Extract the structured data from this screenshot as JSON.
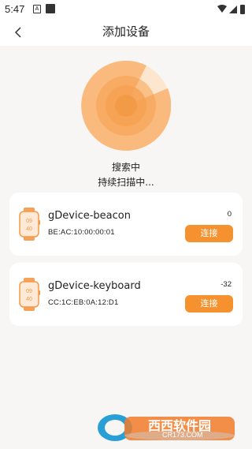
{
  "status_bar": {
    "time": "5:47"
  },
  "header": {
    "title": "添加设备"
  },
  "search": {
    "status": "搜索中",
    "sub_status": "持续扫描中..."
  },
  "devices": [
    {
      "name": "gDevice-beacon",
      "mac": "BE:AC:10:00:00:01",
      "rssi": "0",
      "connect_label": "连接"
    },
    {
      "name": "gDevice-keyboard",
      "mac": "CC:1C:EB:0A:12:D1",
      "rssi": "-32",
      "connect_label": "连接"
    }
  ],
  "watch_icon": {
    "line1": "09",
    "line2": "40"
  },
  "watermark": {
    "brand": "西西",
    "site": "软件园",
    "url": "CR173.COM"
  },
  "colors": {
    "accent": "#f5922f",
    "background": "#f7f6f4",
    "radar_light": "#fde6cf"
  }
}
